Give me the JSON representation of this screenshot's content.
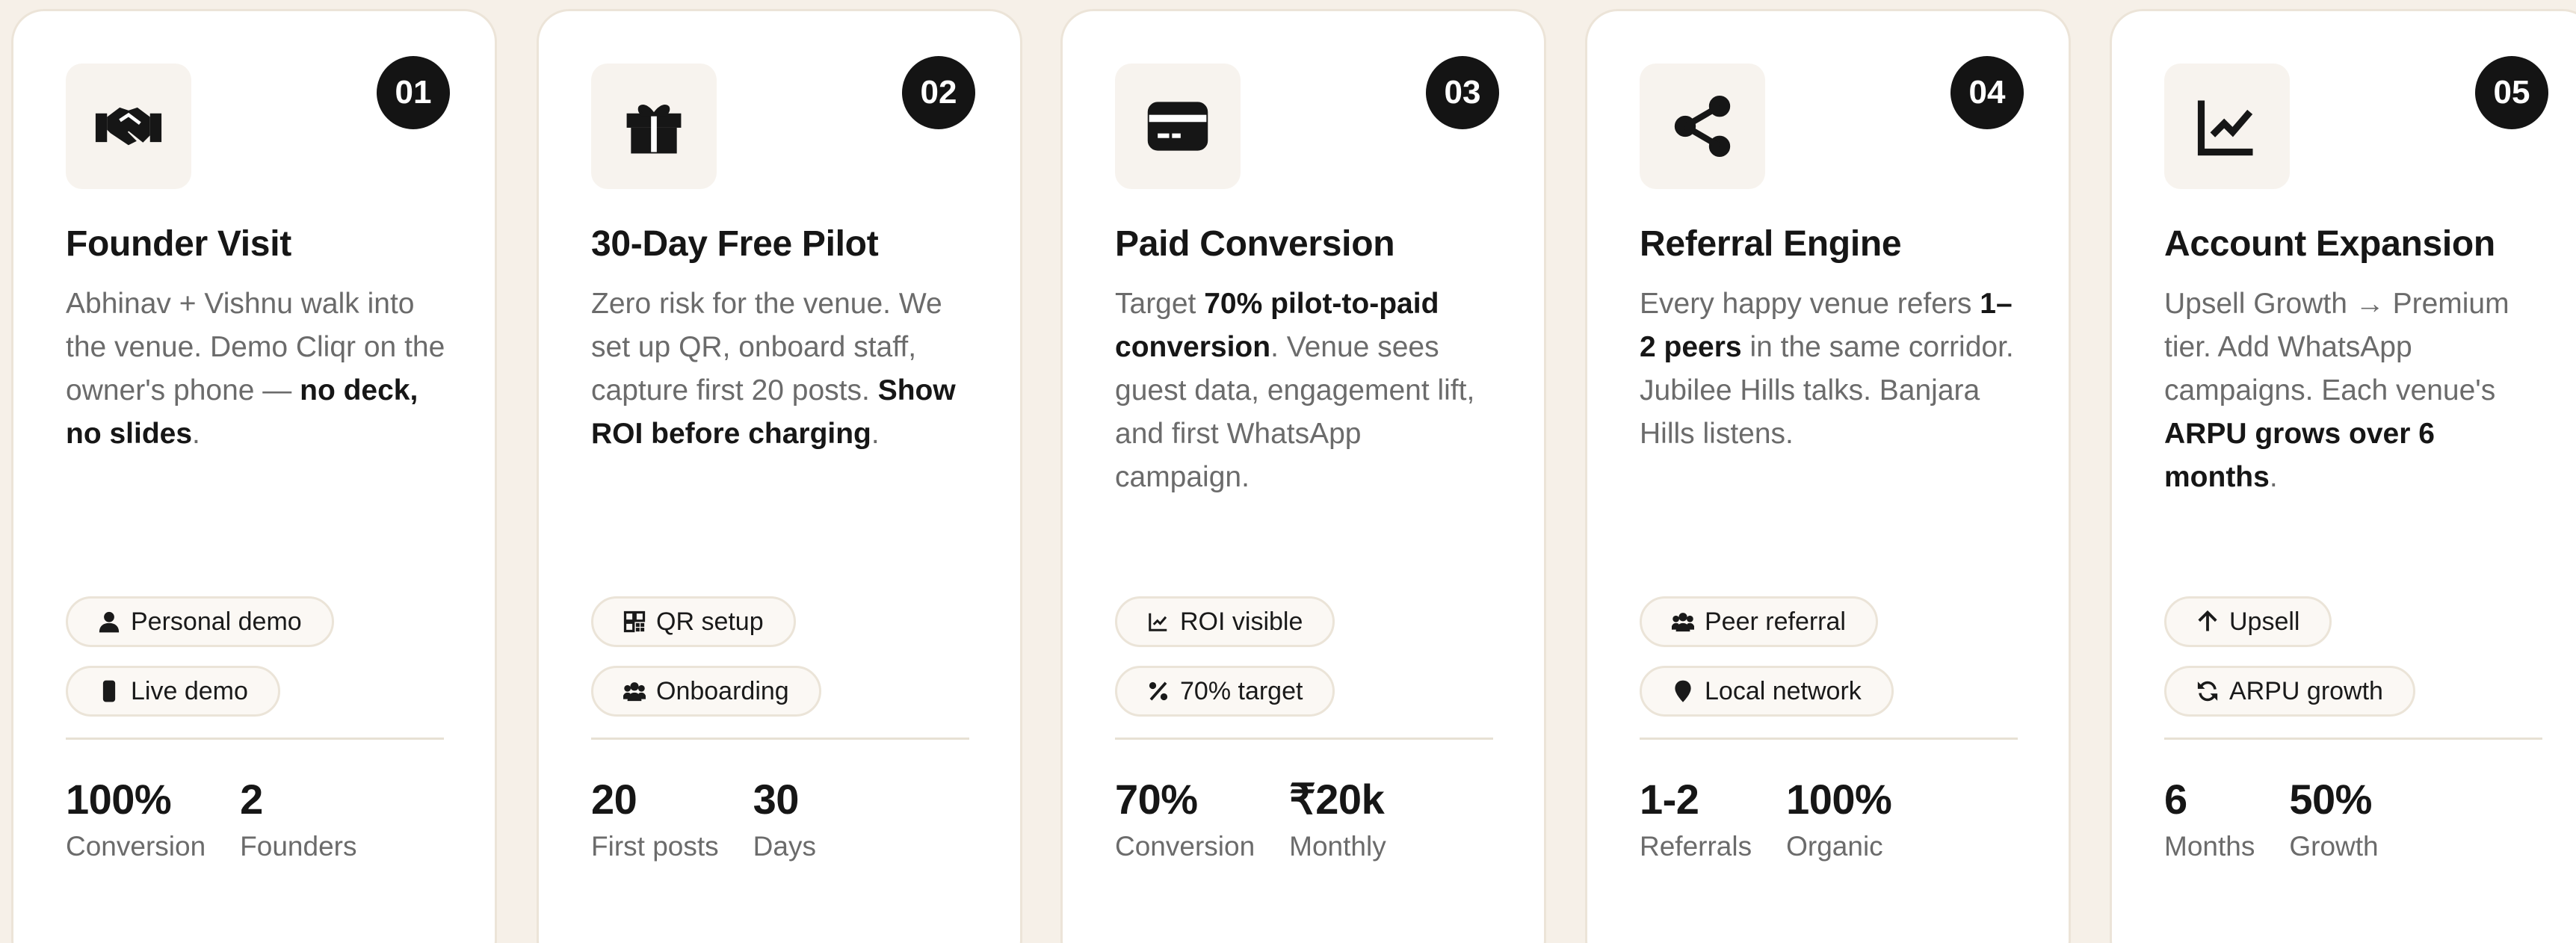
{
  "cards": [
    {
      "number": "01",
      "icon": "handshake-icon",
      "title": "Founder Visit",
      "description": [
        {
          "text": "Abhinav + Vishnu walk into the venue. Demo Cliqr on the owner's phone — ",
          "bold": false
        },
        {
          "text": "no deck, no slides",
          "bold": true
        },
        {
          "text": ".",
          "bold": false
        }
      ],
      "tags": [
        {
          "icon": "user-icon",
          "label": "Personal demo"
        },
        {
          "icon": "phone-icon",
          "label": "Live demo"
        }
      ],
      "stats": [
        {
          "value": "100%",
          "label": "Conversion"
        },
        {
          "value": "2",
          "label": "Founders"
        }
      ]
    },
    {
      "number": "02",
      "icon": "gift-icon",
      "title": "30-Day Free Pilot",
      "description": [
        {
          "text": "Zero risk for the venue. We set up QR, onboard staff, capture first 20 posts. ",
          "bold": false
        },
        {
          "text": "Show ROI before charging",
          "bold": true
        },
        {
          "text": ".",
          "bold": false
        }
      ],
      "tags": [
        {
          "icon": "qr-code-icon",
          "label": "QR setup"
        },
        {
          "icon": "users-icon",
          "label": "Onboarding"
        }
      ],
      "stats": [
        {
          "value": "20",
          "label": "First posts"
        },
        {
          "value": "30",
          "label": "Days"
        }
      ]
    },
    {
      "number": "03",
      "icon": "credit-card-icon",
      "title": "Paid Conversion",
      "description": [
        {
          "text": "Target ",
          "bold": false
        },
        {
          "text": "70% pilot-to-paid conversion",
          "bold": true
        },
        {
          "text": ". Venue sees guest data, engagement lift, and first WhatsApp campaign.",
          "bold": false
        }
      ],
      "tags": [
        {
          "icon": "line-chart-icon",
          "label": "ROI visible"
        },
        {
          "icon": "percent-icon",
          "label": "70% target"
        }
      ],
      "stats": [
        {
          "value": "70%",
          "label": "Conversion"
        },
        {
          "value": "₹20k",
          "label": "Monthly"
        }
      ]
    },
    {
      "number": "04",
      "icon": "share-icon",
      "title": "Referral Engine",
      "description": [
        {
          "text": "Every happy venue refers ",
          "bold": false
        },
        {
          "text": "1–2 peers",
          "bold": true
        },
        {
          "text": " in the same corridor. Jubilee Hills talks. Banjara Hills listens.",
          "bold": false
        }
      ],
      "tags": [
        {
          "icon": "users-icon",
          "label": "Peer referral"
        },
        {
          "icon": "location-pin-icon",
          "label": "Local network"
        }
      ],
      "stats": [
        {
          "value": "1-2",
          "label": "Referrals"
        },
        {
          "value": "100%",
          "label": "Organic"
        }
      ]
    },
    {
      "number": "05",
      "icon": "line-chart-icon",
      "title": "Account Expansion",
      "description": [
        {
          "text": "Upsell Growth → Premium tier. Add WhatsApp campaigns. Each venue's ",
          "bold": false
        },
        {
          "text": "ARPU grows over 6 months",
          "bold": true
        },
        {
          "text": ".",
          "bold": false
        }
      ],
      "tags": [
        {
          "icon": "arrow-up-icon",
          "label": "Upsell"
        },
        {
          "icon": "refresh-icon",
          "label": "ARPU growth"
        }
      ],
      "stats": [
        {
          "value": "6",
          "label": "Months"
        },
        {
          "value": "50%",
          "label": "Growth"
        }
      ]
    }
  ]
}
